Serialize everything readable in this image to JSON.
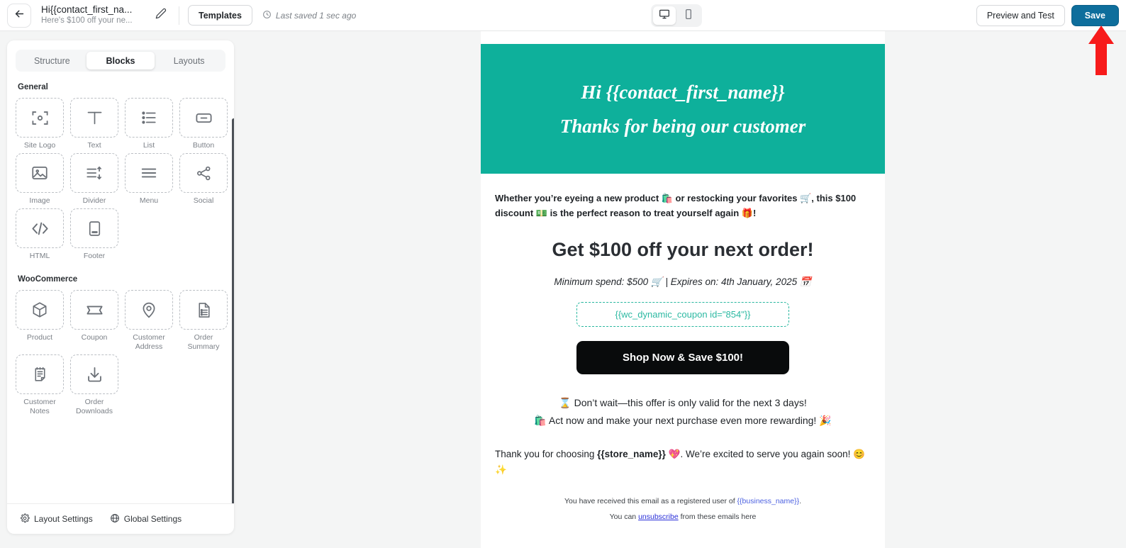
{
  "topbar": {
    "back_icon": "arrow-left-icon",
    "title": "Hi{{contact_first_na...",
    "subtitle": "Here's $100 off your ne...",
    "pencil_icon": "pencil-icon",
    "templates_label": "Templates",
    "clock_icon": "clock-icon",
    "saved_status": "Last saved 1 sec ago",
    "device_desktop_icon": "desktop-icon",
    "device_mobile_icon": "mobile-icon",
    "preview_label": "Preview and Test",
    "save_label": "Save",
    "save_bg": "#0e6e9c",
    "annotation_arrow": "red-up-arrow"
  },
  "sidebar": {
    "tabs": [
      {
        "label": "Structure",
        "active": false
      },
      {
        "label": "Blocks",
        "active": true
      },
      {
        "label": "Layouts",
        "active": false
      }
    ],
    "groups": [
      {
        "title": "General",
        "blocks": [
          {
            "label": "Site Logo",
            "icon": "site-logo-icon"
          },
          {
            "label": "Text",
            "icon": "text-icon"
          },
          {
            "label": "List",
            "icon": "list-icon"
          },
          {
            "label": "Button",
            "icon": "button-icon"
          },
          {
            "label": "Image",
            "icon": "image-icon"
          },
          {
            "label": "Divider",
            "icon": "divider-icon"
          },
          {
            "label": "Menu",
            "icon": "menu-icon"
          },
          {
            "label": "Social",
            "icon": "social-share-icon"
          },
          {
            "label": "HTML",
            "icon": "code-icon"
          },
          {
            "label": "Footer",
            "icon": "footer-icon"
          }
        ]
      },
      {
        "title": "WooCommerce",
        "blocks": [
          {
            "label": "Product",
            "icon": "box-icon"
          },
          {
            "label": "Coupon",
            "icon": "ticket-icon"
          },
          {
            "label": "Customer Address",
            "icon": "map-pin-icon"
          },
          {
            "label": "Order Summary",
            "icon": "document-list-icon"
          },
          {
            "label": "Customer Notes",
            "icon": "notes-icon"
          },
          {
            "label": "Order Downloads",
            "icon": "download-icon"
          }
        ]
      }
    ],
    "footer": {
      "layout_settings": "Layout Settings",
      "layout_icon": "gear-icon",
      "global_settings": "Global Settings",
      "global_icon": "globe-icon"
    },
    "scrollbar": "vertical-scrollbar"
  },
  "email": {
    "header_bg": "#0eb09b",
    "header_line1": "Hi {{contact_first_name}}",
    "header_line2": "Thanks for being our customer",
    "intro": "Whether you’re eyeing a new product 🛍️ or restocking your favorites 🛒, this $100 discount 💵 is the perfect reason to treat yourself again 🎁!",
    "headline": "Get $100 off your next order!",
    "meta": "Minimum spend: $500 🛒 | Expires on: 4th January, 2025 📅",
    "coupon_placeholder": "{{wc_dynamic_coupon id=\"854\"}}",
    "coupon_color": "#2cb9a2",
    "cta_label": "Shop Now & Save $100!",
    "cta_bg": "#090b0c",
    "urgency_line1": "⌛ Don’t wait—this offer is only valid for the next 3 days!",
    "urgency_line2": "🛍️ Act now and make your next purchase even more rewarding! 🎉",
    "thanks_pre": "Thank you for choosing ",
    "thanks_store": "{{store_name}}",
    "thanks_post": " 💖. We’re excited to serve you again soon! 😊✨",
    "footer_line1_pre": "You have received this email as a registered user of ",
    "footer_line1_ph": "{{business_name}}",
    "footer_line1_post": ".",
    "footer_line2_pre": "You can ",
    "footer_line2_link": "unsubscribe",
    "footer_line2_post": " from these emails here"
  }
}
